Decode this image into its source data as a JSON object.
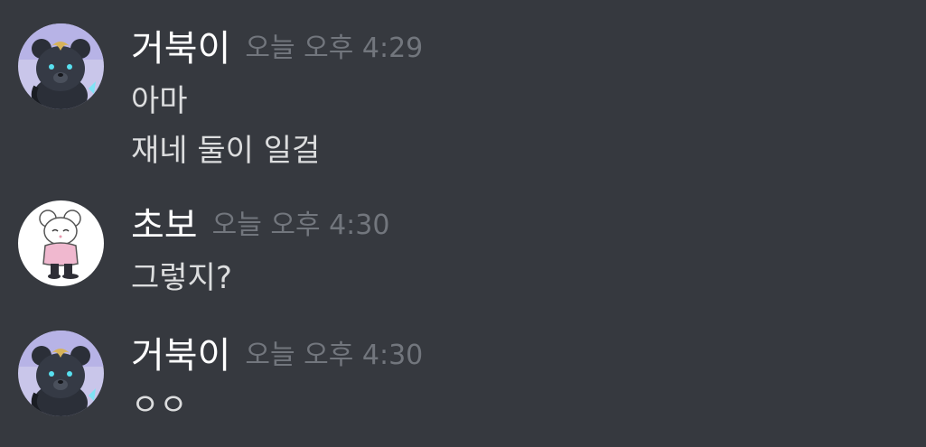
{
  "messages": [
    {
      "author": "거북이",
      "timestamp": "오늘 오후 4:29",
      "avatar_icon": "dark-bear-avatar-icon",
      "lines": [
        "아마",
        "재네 둘이 일걸"
      ]
    },
    {
      "author": "초보",
      "timestamp": "오늘 오후 4:30",
      "avatar_icon": "white-mouse-avatar-icon",
      "lines": [
        "그렇지?"
      ]
    },
    {
      "author": "거북이",
      "timestamp": "오늘 오후 4:30",
      "avatar_icon": "dark-bear-avatar-icon",
      "lines": [
        "ㅇㅇ"
      ]
    }
  ],
  "colors": {
    "background": "#36393f",
    "username": "#ffffff",
    "timestamp": "#72767d",
    "message_text": "#dcddde"
  }
}
